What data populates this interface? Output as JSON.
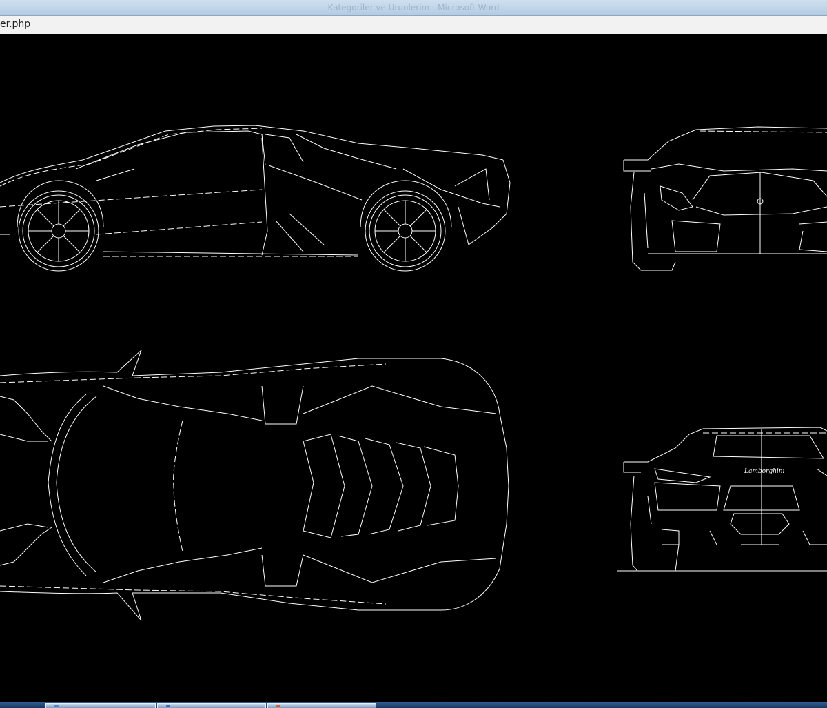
{
  "window": {
    "title": "Kategoriler ve Urunlerim - Microsoft Word"
  },
  "address_bar": {
    "url": "er.php"
  },
  "drawing": {
    "views": [
      {
        "id": "side-view"
      },
      {
        "id": "front-view"
      },
      {
        "id": "top-view"
      },
      {
        "id": "rear-view"
      }
    ],
    "rear_badge_text": "Lamborghini"
  },
  "taskbar": {
    "buttons": [
      {
        "id": "task-1",
        "color": "#4f88c8"
      },
      {
        "id": "task-2",
        "color": "#3a6fb0"
      },
      {
        "id": "task-3",
        "color": "#e05a2b"
      }
    ]
  }
}
